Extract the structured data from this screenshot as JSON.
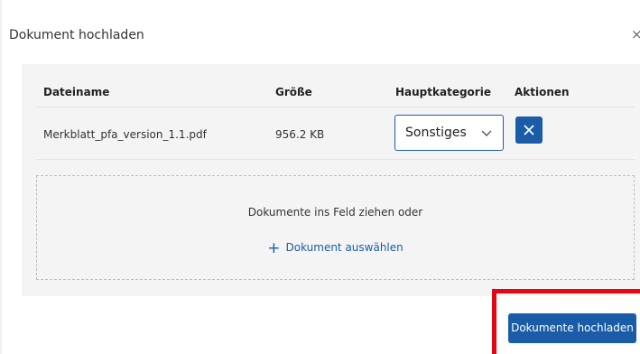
{
  "modal": {
    "title": "Dokument hochladen",
    "close_glyph": "×"
  },
  "table": {
    "headers": [
      "Dateiname",
      "Größe",
      "Hauptkategorie",
      "Aktionen"
    ],
    "rows": [
      {
        "filename": "Merkblatt_pfa_version_1.1.pdf",
        "size": "956.2 KB",
        "category": "Sonstiges"
      }
    ]
  },
  "dropzone": {
    "text": "Dokumente ins Feld ziehen oder",
    "choose_label": "Dokument auswählen",
    "choose_icon": "+"
  },
  "footer": {
    "upload_label": "Dokumente hochladen"
  },
  "colors": {
    "accent": "#1a5ca8",
    "highlight": "#e30613",
    "panel_bg": "#f4f4f4"
  }
}
